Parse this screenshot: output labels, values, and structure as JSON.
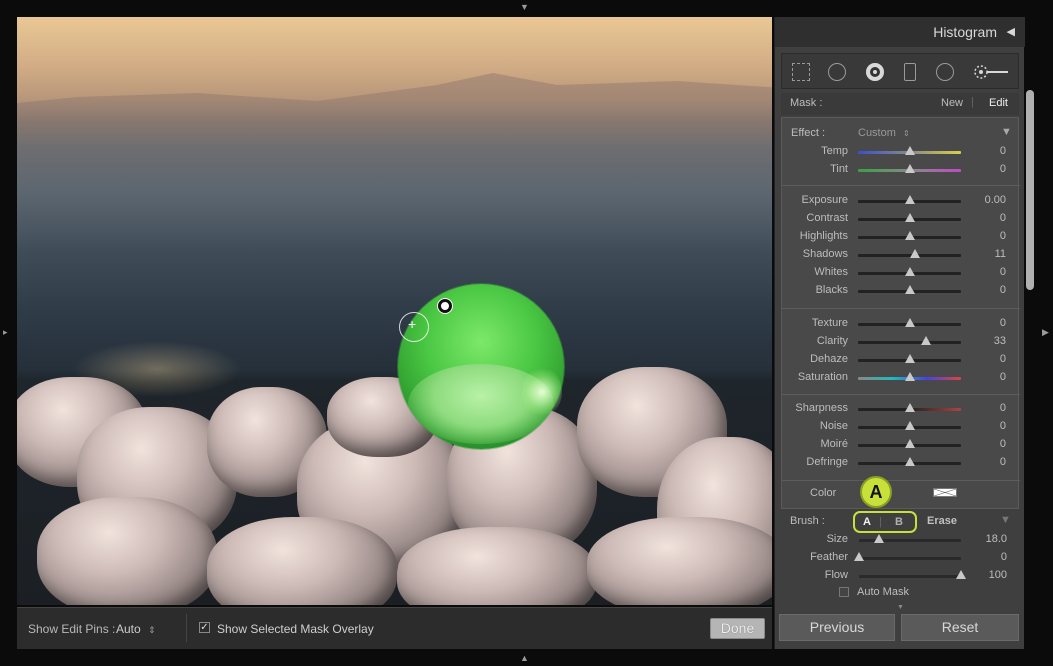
{
  "histogram": {
    "title": "Histogram"
  },
  "mask": {
    "label": "Mask :",
    "new": "New",
    "edit": "Edit"
  },
  "effect": {
    "label": "Effect :",
    "value": "Custom"
  },
  "sliders": [
    {
      "label": "Temp",
      "value": "0",
      "pos": 0.5
    },
    {
      "label": "Tint",
      "value": "0",
      "pos": 0.5
    },
    {
      "label": "Exposure",
      "value": "0.00",
      "pos": 0.5
    },
    {
      "label": "Contrast",
      "value": "0",
      "pos": 0.5
    },
    {
      "label": "Highlights",
      "value": "0",
      "pos": 0.5
    },
    {
      "label": "Shadows",
      "value": "11",
      "pos": 0.555
    },
    {
      "label": "Whites",
      "value": "0",
      "pos": 0.5
    },
    {
      "label": "Blacks",
      "value": "0",
      "pos": 0.5
    },
    {
      "label": "Texture",
      "value": "0",
      "pos": 0.5
    },
    {
      "label": "Clarity",
      "value": "33",
      "pos": 0.665
    },
    {
      "label": "Dehaze",
      "value": "0",
      "pos": 0.5
    },
    {
      "label": "Saturation",
      "value": "0",
      "pos": 0.5
    },
    {
      "label": "Sharpness",
      "value": "0",
      "pos": 0.5
    },
    {
      "label": "Noise",
      "value": "0",
      "pos": 0.5
    },
    {
      "label": "Moiré",
      "value": "0",
      "pos": 0.5
    },
    {
      "label": "Defringe",
      "value": "0",
      "pos": 0.5
    }
  ],
  "color": {
    "label": "Color"
  },
  "brush": {
    "label": "Brush :",
    "a": "A",
    "b": "B",
    "erase": "Erase"
  },
  "brush_sliders": [
    {
      "label": "Size",
      "value": "18.0",
      "pos": 0.2
    },
    {
      "label": "Feather",
      "value": "0",
      "pos": 0.0
    },
    {
      "label": "Flow",
      "value": "100",
      "pos": 1.0
    }
  ],
  "auto_mask": "Auto Mask",
  "callout": "A",
  "toolbar": {
    "show_edit_pins_label": "Show Edit Pins :",
    "show_edit_pins_value": "Auto",
    "overlay_label": "Show Selected Mask Overlay",
    "done": "Done"
  },
  "footer": {
    "previous": "Previous",
    "reset": "Reset"
  },
  "colors": {
    "accent": "#c7e03a",
    "mask_overlay": "#4bc844"
  }
}
